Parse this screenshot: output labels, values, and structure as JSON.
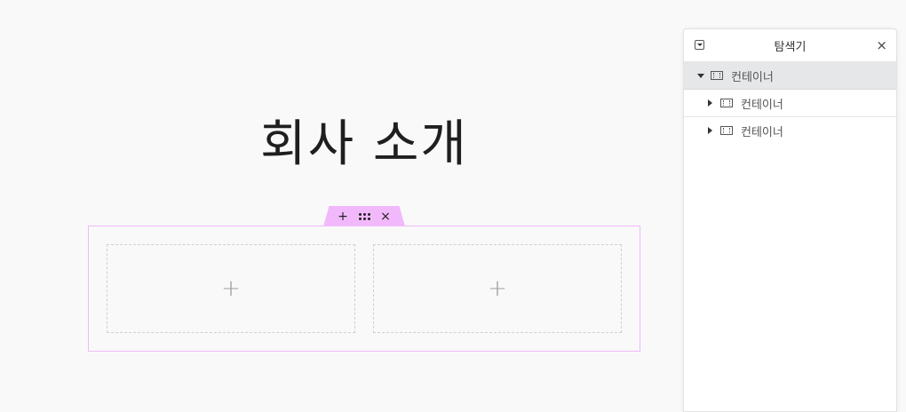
{
  "canvas": {
    "page_title": "회사 소개",
    "section_handle": {
      "add_icon": "+",
      "drag_icon": "drag-handle-icon",
      "close_icon": "×"
    },
    "columns": [
      {
        "add_icon": "+"
      },
      {
        "add_icon": "+"
      }
    ]
  },
  "navigator": {
    "title": "탐색기",
    "close_icon": "×",
    "tree": [
      {
        "label": "컨테이너",
        "expanded": true,
        "selected": true,
        "level": 0
      },
      {
        "label": "컨테이너",
        "expanded": false,
        "selected": false,
        "level": 1
      },
      {
        "label": "컨테이너",
        "expanded": false,
        "selected": false,
        "level": 1
      }
    ]
  },
  "colors": {
    "background": "#f9f9f9",
    "selection_accent": "#f1b9fb",
    "column_dashed_border": "#cfcfcf",
    "navigator_selected_row": "#e6e7e9"
  }
}
